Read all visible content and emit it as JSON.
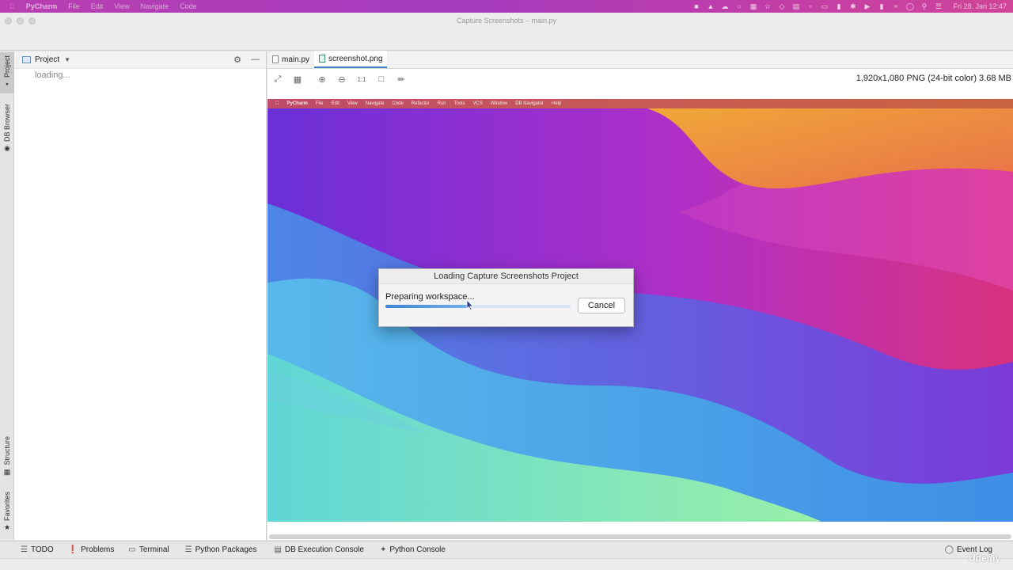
{
  "menubar": {
    "app_name": "PyCharm",
    "items": [
      "File",
      "Edit",
      "View",
      "Navigate",
      "Code"
    ],
    "clock": "Fri 28. Jan  12:47"
  },
  "window": {
    "title": "Capture Screenshots – main.py"
  },
  "left_stripe": {
    "project_label": "Project",
    "db_browser_label": "DB Browser",
    "structure_label": "Structure",
    "favorites_label": "Favorites"
  },
  "project_panel": {
    "title": "Project",
    "loading_text": "loading..."
  },
  "editor": {
    "tabs": [
      {
        "label": "main.py"
      },
      {
        "label": "screenshot.png"
      }
    ],
    "image_info": "1,920x1,080 PNG (24-bit color) 3.68 MB"
  },
  "preview": {
    "menu_items": [
      "PyCharm",
      "File",
      "Edit",
      "View",
      "Navigate",
      "Code",
      "Refactor",
      "Run",
      "Tools",
      "VCS",
      "Window",
      "DB Navigator",
      "Help"
    ]
  },
  "dialog": {
    "title": "Loading Capture Screenshots Project",
    "message": "Preparing workspace...",
    "progress": 0.45,
    "cancel_label": "Cancel"
  },
  "bottom_bar": {
    "todo": "TODO",
    "problems": "Problems",
    "terminal": "Terminal",
    "python_packages": "Python Packages",
    "db_execution_console": "DB Execution Console",
    "python_console": "Python Console",
    "event_log": "Event Log"
  },
  "watermark": "Udemy",
  "colors": {
    "accent": "#4083c9",
    "menubar": "#a33bbf"
  }
}
